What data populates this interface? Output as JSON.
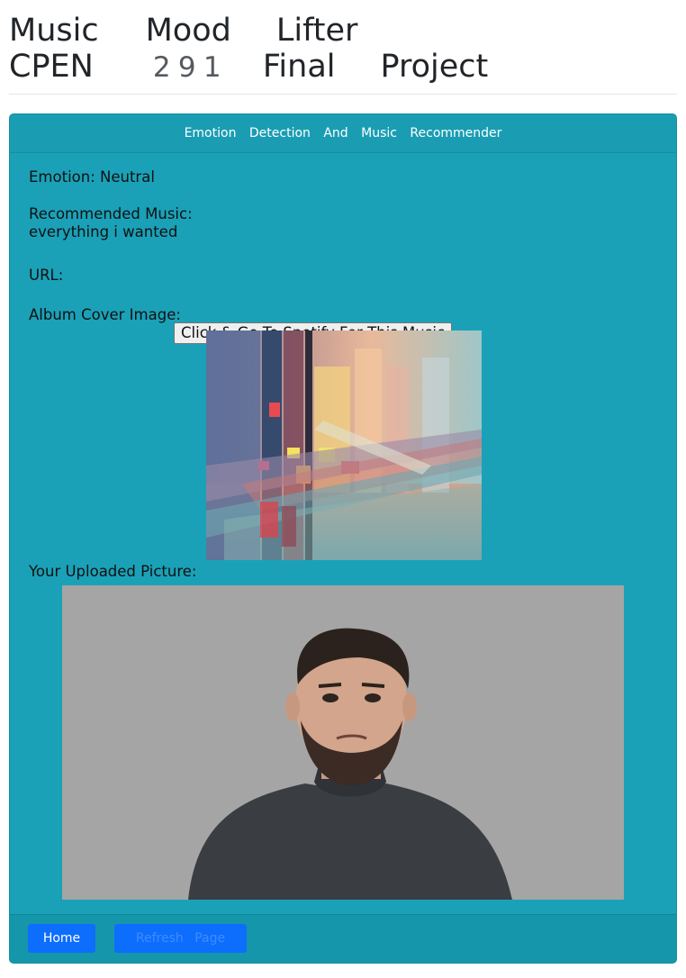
{
  "header": {
    "title_words": [
      "Music",
      "Mood",
      "Lifter"
    ],
    "subtitle_words": [
      "CPEN",
      "Final",
      "Project"
    ],
    "course_number_digits": [
      "2",
      "9",
      "1"
    ]
  },
  "card": {
    "header_title": "Emotion Detection And Music Recommender",
    "emotion_text": "Emotion: Neutral",
    "recommended_label": "Recommended Music:",
    "recommended_value": "everything i wanted",
    "url_label": "URL:",
    "spotify_button_label": "Click & Go To Spotify For This Music",
    "album_label": "Album Cover Image:",
    "uploaded_label": "Your Uploaded Picture:"
  },
  "footer": {
    "home_label": "Home",
    "refresh_label": "Refresh Page"
  },
  "colors": {
    "card_bg": "#1aa1b8",
    "primary_button": "#0d6efd"
  }
}
